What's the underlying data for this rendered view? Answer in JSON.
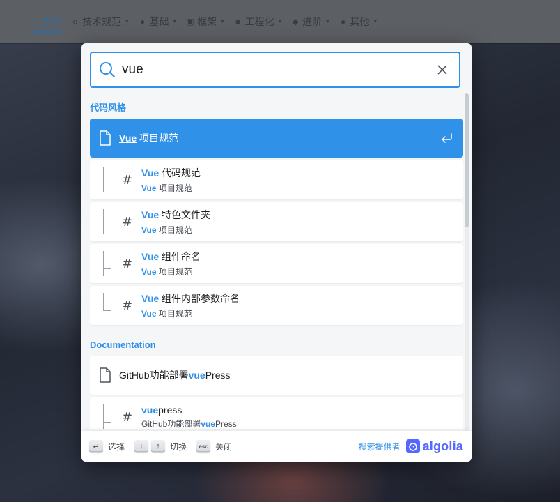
{
  "nav": {
    "items": [
      {
        "icon": "home-icon",
        "glyph": "⌂",
        "label": "主页"
      },
      {
        "icon": "code-icon",
        "glyph": "‹›",
        "label": "技术规范"
      },
      {
        "icon": "bulb-icon",
        "glyph": "●",
        "label": "基础"
      },
      {
        "icon": "frame-icon",
        "glyph": "▣",
        "label": "框架"
      },
      {
        "icon": "book-icon",
        "glyph": "■",
        "label": "工程化"
      },
      {
        "icon": "gem-icon",
        "glyph": "◆",
        "label": "进阶"
      },
      {
        "icon": "dots-icon",
        "glyph": "●",
        "label": "其他"
      }
    ]
  },
  "search": {
    "value": "vue",
    "placeholder": ""
  },
  "sections": [
    {
      "title": "代码风格",
      "main": {
        "highlight": "Vue",
        "rest": " 项目规范"
      },
      "children": [
        {
          "highlight": "Vue",
          "title": " 代码规范",
          "sub_hl": "Vue",
          "sub": " 项目规范"
        },
        {
          "highlight": "Vue",
          "title": " 特色文件夹",
          "sub_hl": "Vue",
          "sub": " 项目规范"
        },
        {
          "highlight": "Vue",
          "title": " 组件命名",
          "sub_hl": "Vue",
          "sub": " 项目规范"
        },
        {
          "highlight": "Vue",
          "title": " 组件内部参数命名",
          "sub_hl": "Vue",
          "sub": " 项目规范"
        }
      ]
    },
    {
      "title": "Documentation",
      "main": {
        "pre": "GitHub功能部署",
        "highlight": "vue",
        "rest": "Press"
      },
      "child": {
        "highlight": "vue",
        "title": "press",
        "sub_pre": "GitHub功能部署",
        "sub_hl": "vue",
        "sub": "Press"
      }
    }
  ],
  "footer": {
    "select": "选择",
    "navigate": "切换",
    "close": "关闭",
    "esc_key": "esc",
    "search_by": "搜索提供者",
    "brand": "algolia"
  },
  "colors": {
    "accent": "#2f91e8",
    "algolia": "#5468ff"
  }
}
